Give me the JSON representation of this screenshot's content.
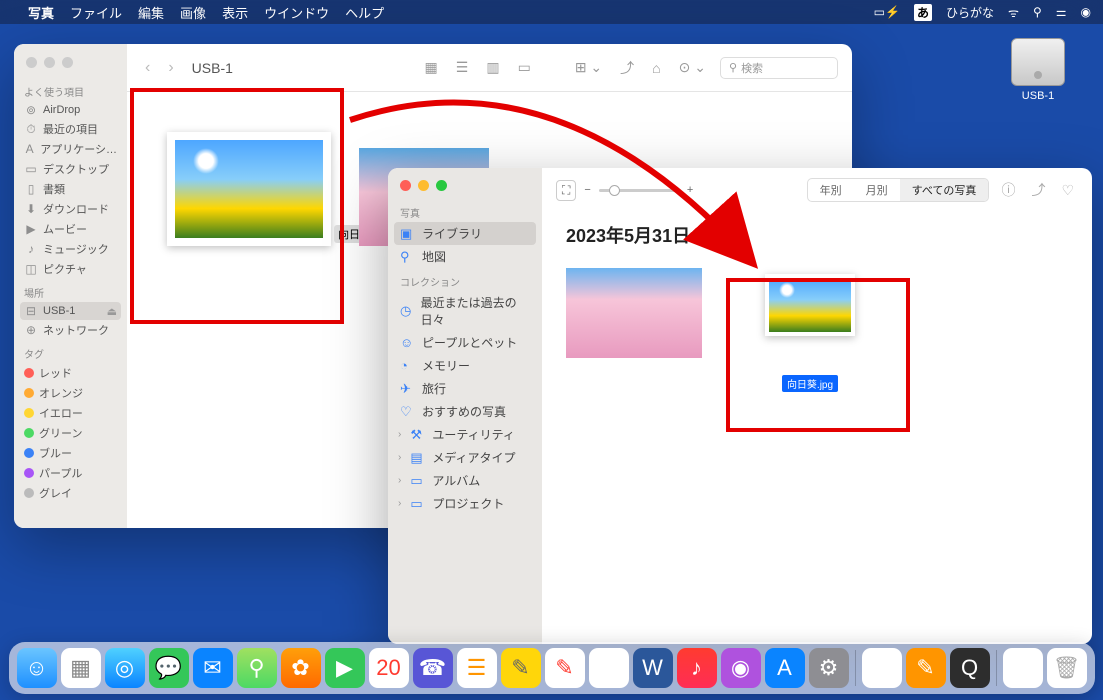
{
  "menubar": {
    "app": "写真",
    "items": [
      "ファイル",
      "編集",
      "画像",
      "表示",
      "ウインドウ",
      "ヘルプ"
    ],
    "ime_label": "あ",
    "ime_mode": "ひらがな"
  },
  "desktop": {
    "usb_label": "USB-1"
  },
  "finder": {
    "title": "USB-1",
    "search_placeholder": "検索",
    "sidebar": {
      "favorites_header": "よく使う項目",
      "favorites": [
        {
          "icon": "⊚",
          "label": "AirDrop"
        },
        {
          "icon": "⏱",
          "label": "最近の項目"
        },
        {
          "icon": "A",
          "label": "アプリケーシ…"
        },
        {
          "icon": "▭",
          "label": "デスクトップ"
        },
        {
          "icon": "▯",
          "label": "書類"
        },
        {
          "icon": "⬇",
          "label": "ダウンロード"
        },
        {
          "icon": "▶",
          "label": "ムービー"
        },
        {
          "icon": "♪",
          "label": "ミュージック"
        },
        {
          "icon": "◫",
          "label": "ピクチャ"
        }
      ],
      "locations_header": "場所",
      "locations": [
        {
          "icon": "⊟",
          "label": "USB-1",
          "selected": true
        },
        {
          "icon": "⊕",
          "label": "ネットワーク"
        }
      ],
      "tags_header": "タグ",
      "tags": [
        {
          "cls": "tag-red",
          "label": "レッド"
        },
        {
          "cls": "tag-orange",
          "label": "オレンジ"
        },
        {
          "cls": "tag-yellow",
          "label": "イエロー"
        },
        {
          "cls": "tag-green",
          "label": "グリーン"
        },
        {
          "cls": "tag-blue",
          "label": "ブルー"
        },
        {
          "cls": "tag-purple",
          "label": "パープル"
        },
        {
          "cls": "tag-gray",
          "label": "グレイ"
        }
      ]
    },
    "files": {
      "main_file": "向日葵.jpg"
    }
  },
  "photos": {
    "sidebar": {
      "section1_header": "写真",
      "section1": [
        {
          "icon": "▣",
          "label": "ライブラリ",
          "selected": true
        },
        {
          "icon": "⚲",
          "label": "地図"
        }
      ],
      "section2_header": "コレクション",
      "section2": [
        {
          "icon": "◷",
          "label": "最近または過去の日々"
        },
        {
          "icon": "☺",
          "label": "ピープルとペット"
        },
        {
          "icon": "◔",
          "label": "メモリー"
        },
        {
          "icon": "✈",
          "label": "旅行"
        },
        {
          "icon": "♡",
          "label": "おすすめの写真"
        },
        {
          "icon": "⚒",
          "label": "ユーティリティ",
          "chev": true
        },
        {
          "icon": "▤",
          "label": "メディアタイプ",
          "chev": true
        },
        {
          "icon": "▭",
          "label": "アルバム",
          "chev": true
        },
        {
          "icon": "▭",
          "label": "プロジェクト",
          "chev": true
        }
      ]
    },
    "toolbar": {
      "segments": [
        "年別",
        "月別",
        "すべての写真"
      ],
      "active_segment": 2
    },
    "content": {
      "date": "2023年5月31日",
      "dragged_file": "向日葵.jpg"
    }
  },
  "colors": {
    "accent_red": "#e30000",
    "selection_blue": "#0a66ff"
  }
}
